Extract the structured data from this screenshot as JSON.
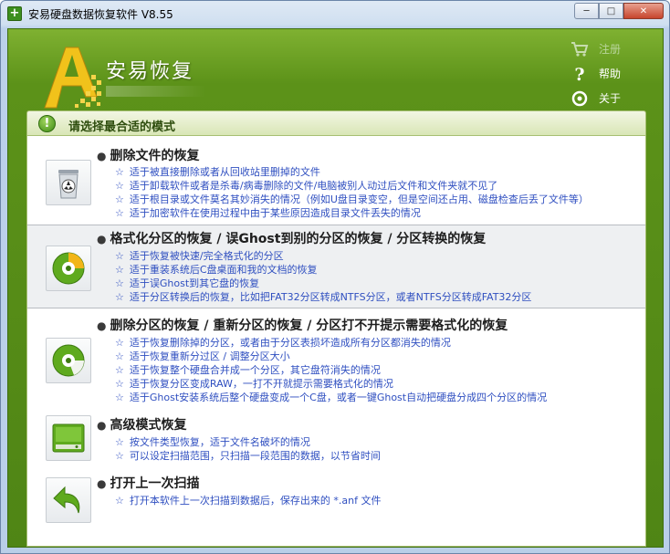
{
  "window": {
    "title": "安易硬盘数据恢复软件 V8.55",
    "min_symbol": "─",
    "max_symbol": "□",
    "close_symbol": "✕"
  },
  "app": {
    "logo_letter": "A",
    "name": "安易恢复"
  },
  "topmenu": [
    {
      "label": "注册",
      "icon": "cart-icon"
    },
    {
      "label": "帮助",
      "icon": "help-icon"
    },
    {
      "label": "关于",
      "icon": "info-icon"
    }
  ],
  "modebar": {
    "icon": "!",
    "text": "请选择最合适的模式"
  },
  "options": [
    {
      "title": "删除文件的恢复",
      "icon": "recycle-bin-icon",
      "lines": [
        "适于被直接删除或者从回收站里删掉的文件",
        "适于卸载软件或者是杀毒/病毒删除的文件/电脑被别人动过后文件和文件夹就不见了",
        "适于根目录或文件莫名其妙消失的情况（例如U盘目录变空，但是空间还占用、磁盘检查后丢了文件等）",
        "适于加密软件在使用过程中由于某些原因造成目录文件丢失的情况"
      ]
    },
    {
      "title": "格式化分区的恢复 / 误Ghost到别的分区的恢复 / 分区转换的恢复",
      "icon": "format-disk-icon",
      "lines": [
        "适于恢复被快速/完全格式化的分区",
        "适于重装系统后C盘桌面和我的文档的恢复",
        "适于误Ghost到其它盘的恢复",
        "适于分区转换后的恢复，比如把FAT32分区转成NTFS分区，或者NTFS分区转成FAT32分区"
      ]
    },
    {
      "title": "删除分区的恢复 / 重新分区的恢复 / 分区打不开提示需要格式化的恢复",
      "icon": "partition-icon",
      "lines": [
        "适于恢复删除掉的分区，或者由于分区表损坏造成所有分区都消失的情况",
        "适于恢复重新分过区 / 调整分区大小",
        "适于恢复整个硬盘合并成一个分区，其它盘符消失的情况",
        "适于恢复分区变成RAW，一打不开就提示需要格式化的情况",
        "适于Ghost安装系统后整个硬盘变成一个C盘，或者一键Ghost自动把硬盘分成四个分区的情况"
      ]
    },
    {
      "title": "高级模式恢复",
      "icon": "hard-drive-icon",
      "lines": [
        "按文件类型恢复，适于文件名破坏的情况",
        "可以设定扫描范围，只扫描一段范围的数据，以节省时间"
      ]
    },
    {
      "title": "打开上一次扫描",
      "icon": "back-arrow-icon",
      "lines": [
        "打开本软件上一次扫描到数据后，保存出来的 *.anf 文件"
      ]
    }
  ],
  "colors": {
    "green_dark": "#4f8515",
    "green_light": "#7fb131",
    "link_blue": "#2f4fc0"
  }
}
